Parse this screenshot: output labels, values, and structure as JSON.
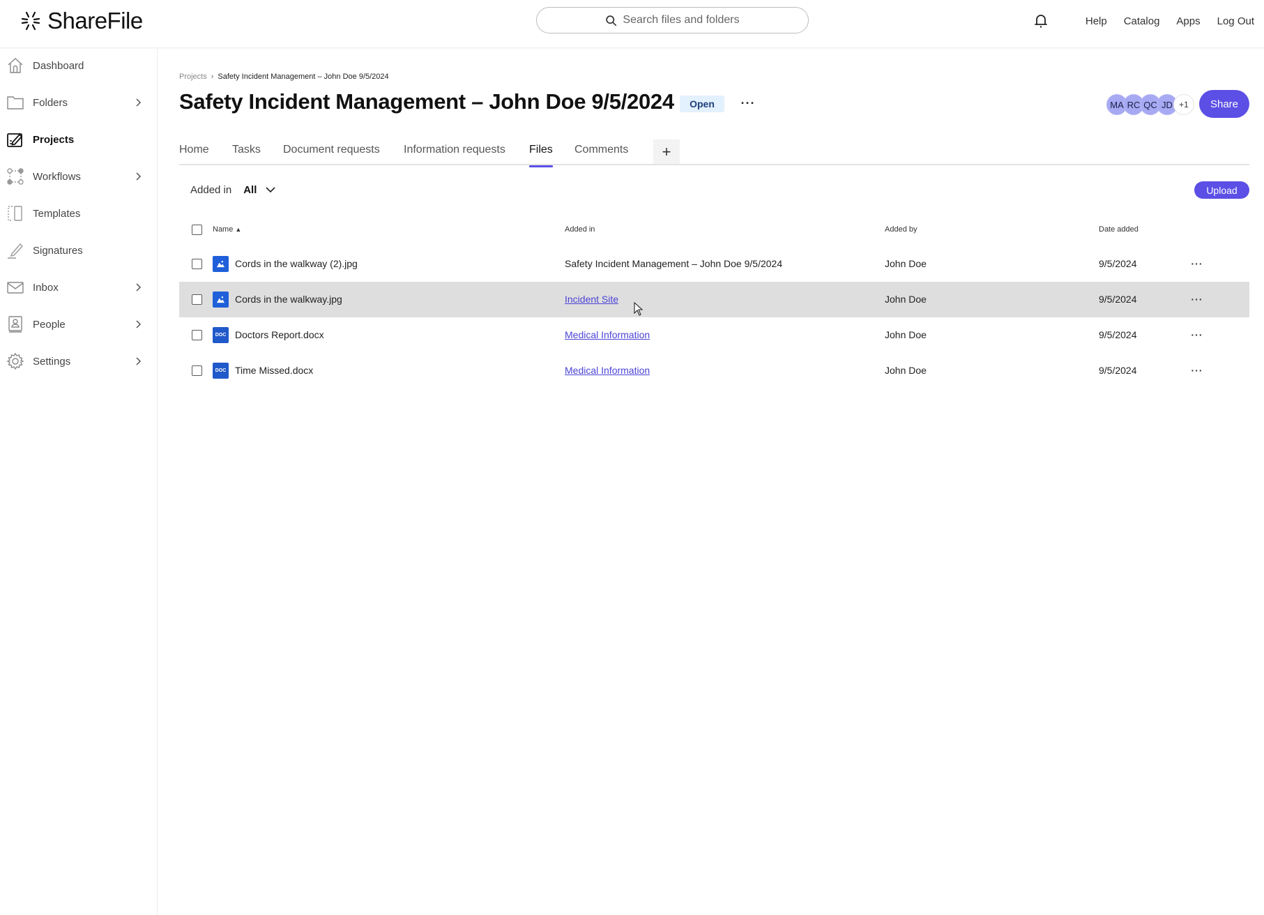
{
  "app": {
    "brand": "ShareFile",
    "search_placeholder": "Search files and folders",
    "header_links": [
      "Help",
      "Catalog",
      "Apps",
      "Log Out"
    ]
  },
  "sidebar": {
    "items": [
      {
        "label": "Dashboard",
        "icon": "home-icon",
        "has_chevron": false,
        "active": false
      },
      {
        "label": "Folders",
        "icon": "folder-icon",
        "has_chevron": true,
        "active": false
      },
      {
        "label": "Projects",
        "icon": "projects-icon",
        "has_chevron": false,
        "active": true
      },
      {
        "label": "Workflows",
        "icon": "workflows-icon",
        "has_chevron": true,
        "active": false
      },
      {
        "label": "Templates",
        "icon": "templates-icon",
        "has_chevron": false,
        "active": false
      },
      {
        "label": "Signatures",
        "icon": "signature-icon",
        "has_chevron": false,
        "active": false
      },
      {
        "label": "Inbox",
        "icon": "inbox-icon",
        "has_chevron": true,
        "active": false
      },
      {
        "label": "People",
        "icon": "people-icon",
        "has_chevron": true,
        "active": false
      },
      {
        "label": "Settings",
        "icon": "gear-icon",
        "has_chevron": true,
        "active": false
      }
    ]
  },
  "breadcrumb": {
    "parent": "Projects",
    "current": "Safety Incident Management – John Doe 9/5/2024"
  },
  "project": {
    "title": "Safety Incident Management – John Doe 9/5/2024",
    "status": "Open",
    "more_label": "···",
    "share_label": "Share",
    "avatars": [
      "MA",
      "RC",
      "QC",
      "JD"
    ],
    "avatars_more": "+1"
  },
  "tabs": [
    {
      "label": "Home",
      "active": false
    },
    {
      "label": "Tasks",
      "active": false
    },
    {
      "label": "Document requests",
      "active": false
    },
    {
      "label": "Information requests",
      "active": false
    },
    {
      "label": "Files",
      "active": true
    },
    {
      "label": "Comments",
      "active": false
    }
  ],
  "tab_add_label": "+",
  "filter": {
    "label": "Added in",
    "value": "All"
  },
  "upload_label": "Upload",
  "table": {
    "columns": {
      "name": "Name",
      "sort_indicator": "▲",
      "added_in": "Added in",
      "added_by": "Added by",
      "date_added": "Date added"
    },
    "rows": [
      {
        "name": "Cords in the walkway (2).jpg",
        "type": "image",
        "added_in": "Safety Incident Management – John Doe 9/5/2024",
        "added_in_link": false,
        "added_by": "John Doe",
        "date_added": "9/5/2024",
        "hovered": false
      },
      {
        "name": "Cords in the walkway.jpg",
        "type": "image",
        "added_in": "Incident Site",
        "added_in_link": true,
        "added_by": "John Doe",
        "date_added": "9/5/2024",
        "hovered": true
      },
      {
        "name": "Doctors Report.docx",
        "type": "doc",
        "added_in": "Medical Information",
        "added_in_link": true,
        "added_by": "John Doe",
        "date_added": "9/5/2024",
        "hovered": false
      },
      {
        "name": "Time Missed.docx",
        "type": "doc",
        "added_in": "Medical Information",
        "added_in_link": true,
        "added_by": "John Doe",
        "date_added": "9/5/2024",
        "hovered": false
      }
    ],
    "row_more_label": "···",
    "doc_icon_label": "DOC"
  },
  "colors": {
    "accent": "#5b4fe6",
    "link": "#4b44d6",
    "file_icon": "#1f5fd9",
    "status_badge_bg": "#e3f0fd",
    "row_hover": "#dedede",
    "avatar": "#a7a9f2"
  }
}
